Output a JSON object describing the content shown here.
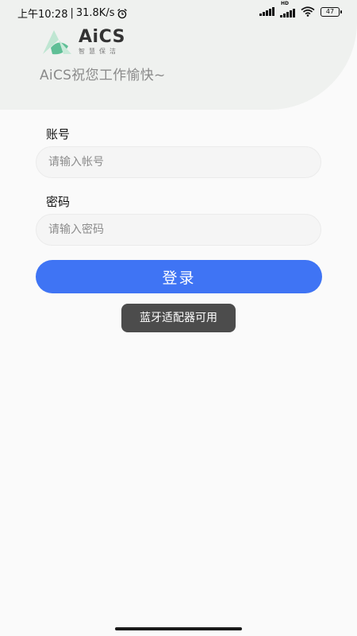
{
  "status_bar": {
    "time": "上午10:28",
    "separator": "|",
    "net_speed": "31.8K/s",
    "alarm_icon": "alarm-clock-icon",
    "hd_badge": "HD",
    "battery_level": "47"
  },
  "brand": {
    "name": "AiCS",
    "subtitle": "智慧保洁",
    "slogan": "AiCS祝您工作愉快~",
    "accent_color": "#5fbf96"
  },
  "form": {
    "account_label": "账号",
    "account_placeholder": "请输入帐号",
    "account_value": "",
    "password_label": "密码",
    "password_placeholder": "请输入密码",
    "password_value": "",
    "login_label": "登录",
    "button_color": "#3f74f4"
  },
  "toast": {
    "message": "蓝牙适配器可用"
  }
}
